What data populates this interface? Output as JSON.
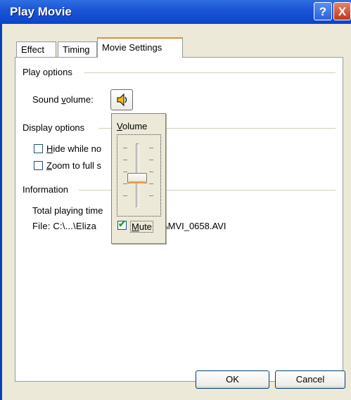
{
  "window": {
    "title": "Play Movie",
    "help_glyph": "?",
    "close_glyph": "X"
  },
  "tabs": [
    {
      "label": "Effect"
    },
    {
      "label": "Timing"
    },
    {
      "label": "Movie Settings",
      "active": true
    }
  ],
  "play_options": {
    "group_label": "Play options",
    "sound_volume_label_pre": "Sound ",
    "sound_volume_label_ul": "v",
    "sound_volume_label_post": "olume:",
    "sound_icon": "speaker-icon"
  },
  "display_options": {
    "group_label": "Display options",
    "hide_label_ul": "H",
    "hide_label_post": "ide while no",
    "zoom_label_ul": "Z",
    "zoom_label_post": "oom to full s"
  },
  "information": {
    "group_label": "Information",
    "total_playing_time": "Total playing time",
    "file_label": "File:  C:\\...\\Eliza",
    "file_suffix": "\\MVI_0658.AVI"
  },
  "volume_popup": {
    "title_ul": "V",
    "title_post": "olume",
    "level_fraction": 0.45,
    "mute_label_ul": "M",
    "mute_label_post": "ute",
    "mute_checked": true
  },
  "buttons": {
    "ok": "OK",
    "cancel": "Cancel"
  },
  "colors": {
    "titlebar": "#1c55d8",
    "dialog_bg": "#ECE9D8",
    "active_tab_accent": "#e68b2c"
  }
}
